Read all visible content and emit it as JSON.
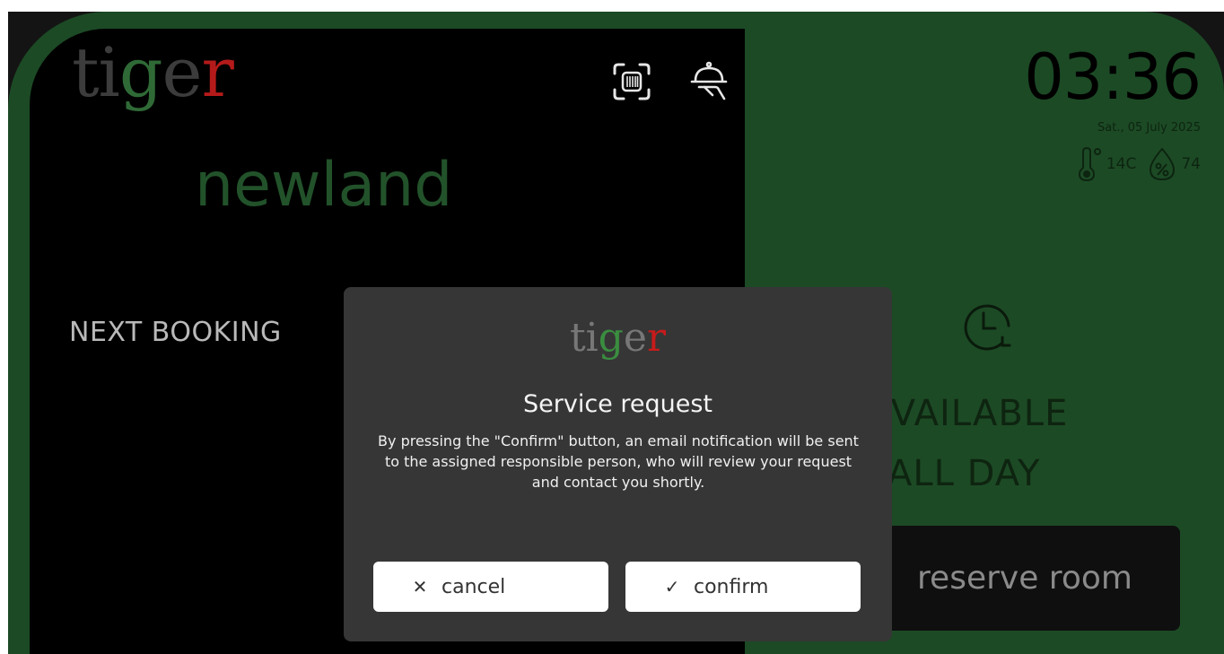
{
  "brand": {
    "part1": "ti",
    "part2": "g",
    "part3": "e",
    "part4": "r"
  },
  "location": "newland",
  "icons": {
    "scan": "barcode-scan-icon",
    "service": "service-bell-icon",
    "thermometer": "thermometer-icon",
    "humidity": "humidity-icon",
    "clock_refresh": "clock-refresh-icon"
  },
  "next_booking_label": "NEXT BOOKING",
  "clock": {
    "time": "03:36",
    "date": "Sat., 05 July 2025"
  },
  "weather": {
    "temperature": "14C",
    "humidity": "74"
  },
  "status": {
    "line1": "AVAILABLE",
    "line2": "ALL DAY"
  },
  "reserve_button": "reserve room",
  "modal": {
    "brand": {
      "part1": "ti",
      "part2": "g",
      "part3": "e",
      "part4": "r"
    },
    "title": "Service request",
    "body": "By pressing the \"Confirm\" button, an email notification will be sent to the assigned responsible person, who will review your request and contact you shortly.",
    "cancel_label": "cancel",
    "confirm_label": "confirm"
  },
  "colors": {
    "screen_green": "#1c4a25",
    "panel_black": "#000000",
    "modal_bg": "#363636",
    "brand_grey": "#3c3c3c",
    "brand_green": "#2f6a36",
    "brand_red": "#b51a1a"
  }
}
